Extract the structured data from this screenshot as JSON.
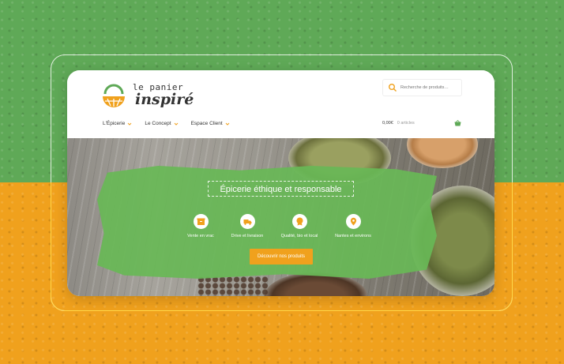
{
  "logo": {
    "line1": "le panier",
    "line2": "inspiré"
  },
  "search": {
    "placeholder": "Recherche de produits…"
  },
  "nav": {
    "items": [
      {
        "label": "L'Épicerie"
      },
      {
        "label": "Le Concept"
      },
      {
        "label": "Espace Client"
      }
    ]
  },
  "cart": {
    "total": "0,00€",
    "count": "0 articles"
  },
  "hero": {
    "title": "Épicerie éthique et responsable",
    "features": [
      {
        "label": "Vente en vrac",
        "icon": "box-icon"
      },
      {
        "label": "Drive et livraison",
        "icon": "truck-icon"
      },
      {
        "label": "Qualité, bio et local",
        "icon": "badge-icon"
      },
      {
        "label": "Nantes et environs",
        "icon": "location-pin-icon"
      }
    ],
    "cta": "Découvrir nos produits"
  },
  "colors": {
    "green": "#5fa957",
    "orange": "#f0a11d",
    "panel_green": "#68b856"
  }
}
